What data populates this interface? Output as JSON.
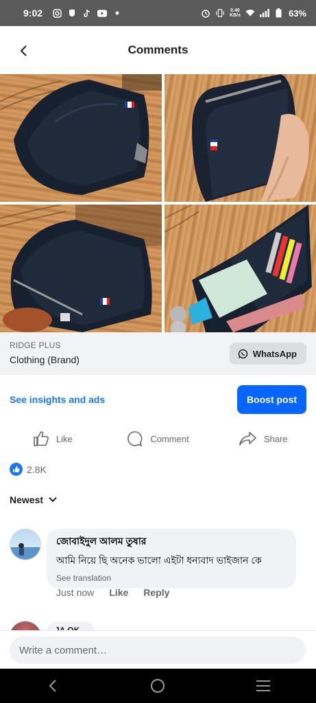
{
  "status_bar": {
    "time": "9:02",
    "net_speed_value": "0.46",
    "net_speed_unit": "KB/s",
    "battery": "63%",
    "icons": [
      "instagram-icon",
      "pocket-icon",
      "tiktok-icon",
      "youtube-icon",
      "dot-icon",
      "alarm-icon",
      "vibrate-icon",
      "wifi-icon",
      "signal-icon",
      "battery-icon"
    ]
  },
  "header": {
    "title": "Comments"
  },
  "post": {
    "photos": [
      "wallet-photo-1",
      "wallet-photo-2",
      "wallet-photo-3",
      "wallet-photo-4"
    ],
    "brand_name": "RIDGE PLUS",
    "brand_category": "Clothing (Brand)",
    "whatsapp_label": "WhatsApp",
    "insights_label": "See insights and ads",
    "boost_label": "Boost post",
    "actions": {
      "like": "Like",
      "comment": "Comment",
      "share": "Share"
    },
    "reactions_count": "2.8K"
  },
  "comments": {
    "sort_label": "Newest",
    "items": [
      {
        "author": "জোবাইদুল আলম তুষার",
        "text": "আমি নিয়ে ছি অনেক ভালো এইটা ধন্যবাদ ভাইজান কে",
        "translate": "See translation",
        "time": "Just now",
        "like": "Like",
        "reply": "Reply"
      },
      {
        "author": "JA OK"
      }
    ]
  },
  "composer": {
    "placeholder": "Write a comment…"
  },
  "colors": {
    "accent": "#0866ff",
    "link": "#1877f2",
    "status_bar": "#5a5a5a"
  }
}
